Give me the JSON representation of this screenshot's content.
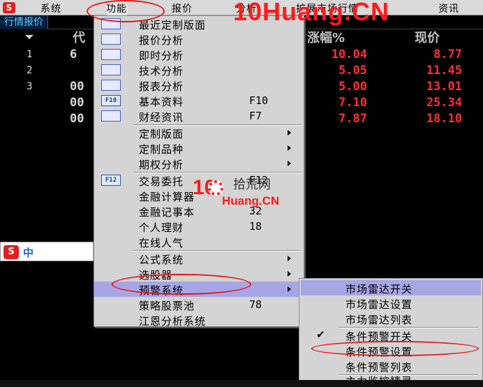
{
  "menubar": {
    "items": [
      "系统",
      "功能",
      "报价",
      "分析",
      "扩展市场行情",
      "资讯"
    ]
  },
  "watermark": {
    "main": "10Huang.CN",
    "logo_ten": "10",
    "logo_cn": "拾荒网",
    "logo_domain": "Huang.CN"
  },
  "quote_tab": "行情报价",
  "table": {
    "headers": [
      "代",
      "涨幅%",
      "现价"
    ],
    "rows": [
      {
        "idx": "1",
        "code": "6",
        "change": "10.04",
        "price": "8.77"
      },
      {
        "idx": "2",
        "code": "",
        "change": "5.05",
        "price": "11.45"
      },
      {
        "idx": "3",
        "code": "00",
        "change": "5.00",
        "price": "13.01"
      },
      {
        "idx": "",
        "code": "00",
        "change": "7.10",
        "price": "25.34"
      },
      {
        "idx": "",
        "code": "00",
        "change": "7.87",
        "price": "18.10"
      }
    ]
  },
  "function_menu": {
    "items": [
      {
        "label": "最近定制版面",
        "key": "",
        "submenu": false
      },
      {
        "label": "报价分析",
        "key": "",
        "submenu": false
      },
      {
        "label": "即时分析",
        "key": "",
        "submenu": false
      },
      {
        "label": "技术分析",
        "key": "",
        "submenu": false
      },
      {
        "label": "报表分析",
        "key": "",
        "submenu": false
      },
      {
        "label": "基本资料",
        "key": "F10",
        "submenu": false
      },
      {
        "label": "财经资讯",
        "key": "F7",
        "submenu": false
      },
      {
        "label": "定制版面",
        "key": "",
        "submenu": true
      },
      {
        "label": "定制品种",
        "key": "",
        "submenu": true
      },
      {
        "label": "期权分析",
        "key": "",
        "submenu": true
      },
      {
        "label": "交易委托",
        "key": "F12",
        "submenu": false
      },
      {
        "label": "金融计算器",
        "key": "",
        "submenu": false
      },
      {
        "label": "金融记事本",
        "key": "32",
        "submenu": false
      },
      {
        "label": "个人理财",
        "key": "18",
        "submenu": false
      },
      {
        "label": "在线人气",
        "key": "",
        "submenu": false
      },
      {
        "label": "公式系统",
        "key": "",
        "submenu": true
      },
      {
        "label": "选股器",
        "key": "",
        "submenu": true
      },
      {
        "label": "预警系统",
        "key": "",
        "submenu": true
      },
      {
        "label": "策略股票池",
        "key": "78",
        "submenu": false
      },
      {
        "label": "江恩分析系统",
        "key": "",
        "submenu": false
      }
    ]
  },
  "alert_submenu": {
    "items": [
      {
        "label": "市场雷达开关",
        "checked": false
      },
      {
        "label": "市场雷达设置",
        "checked": false
      },
      {
        "label": "市场雷达列表",
        "checked": false
      },
      {
        "label": "条件预警开关",
        "checked": true
      },
      {
        "label": "条件预警设置",
        "checked": false
      },
      {
        "label": "条件预警列表",
        "checked": false
      },
      {
        "label": "主力监控精灵",
        "checked": false
      }
    ]
  },
  "ime": {
    "label": "中"
  },
  "icons": {
    "f10": "F10",
    "f12": "F12"
  }
}
